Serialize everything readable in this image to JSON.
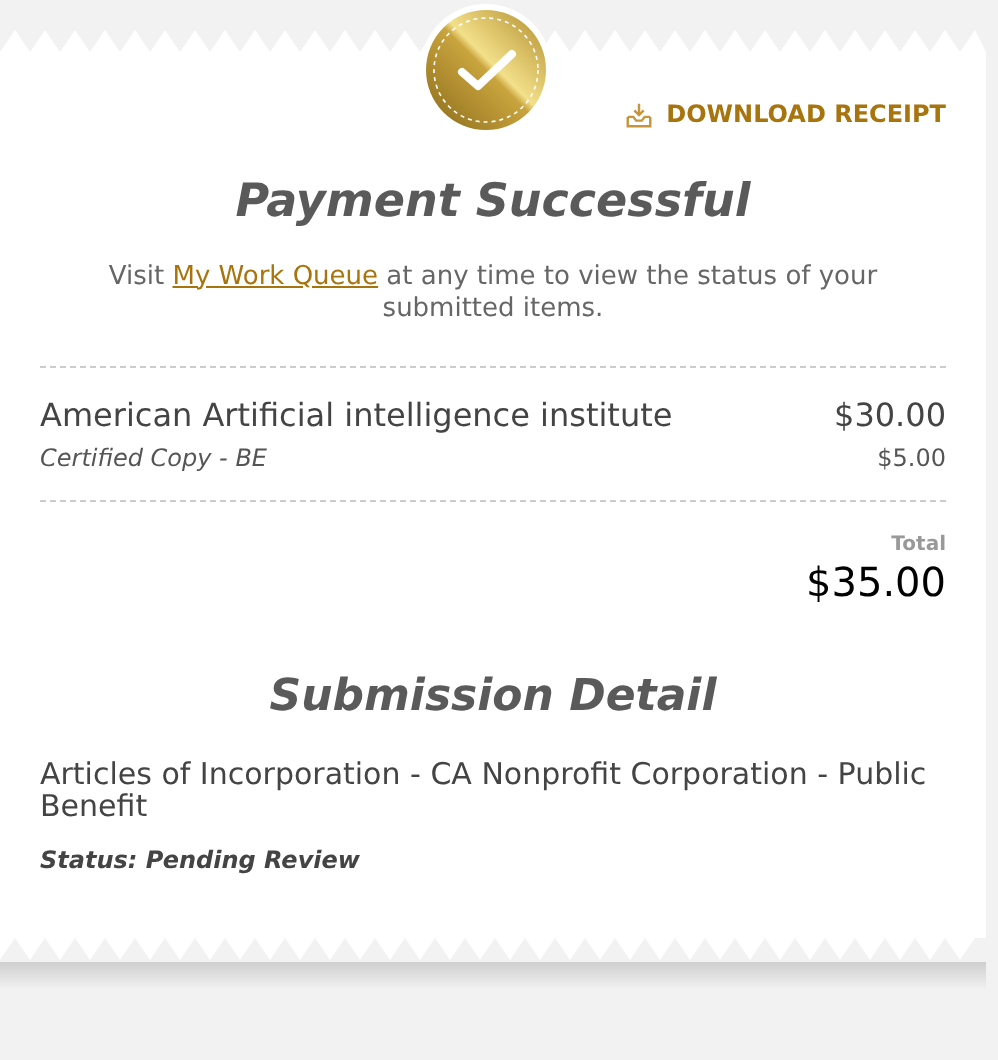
{
  "download_button": {
    "label": "DOWNLOAD RECEIPT"
  },
  "title": "Payment Successful",
  "intro": {
    "before": "Visit ",
    "link": "My Work Queue",
    "after": " at any time to view the status of your submitted items."
  },
  "items": [
    {
      "name": "American Artificial intelligence institute",
      "price": "$30.00",
      "detail": "Certified Copy - BE",
      "detail_price": "$5.00"
    }
  ],
  "total": {
    "label": "Total",
    "amount": "$35.00"
  },
  "submission": {
    "heading": "Submission Detail",
    "document": "Articles of Incorporation - CA Nonprofit Corporation - Public Benefit",
    "status": "Status: Pending Review"
  }
}
